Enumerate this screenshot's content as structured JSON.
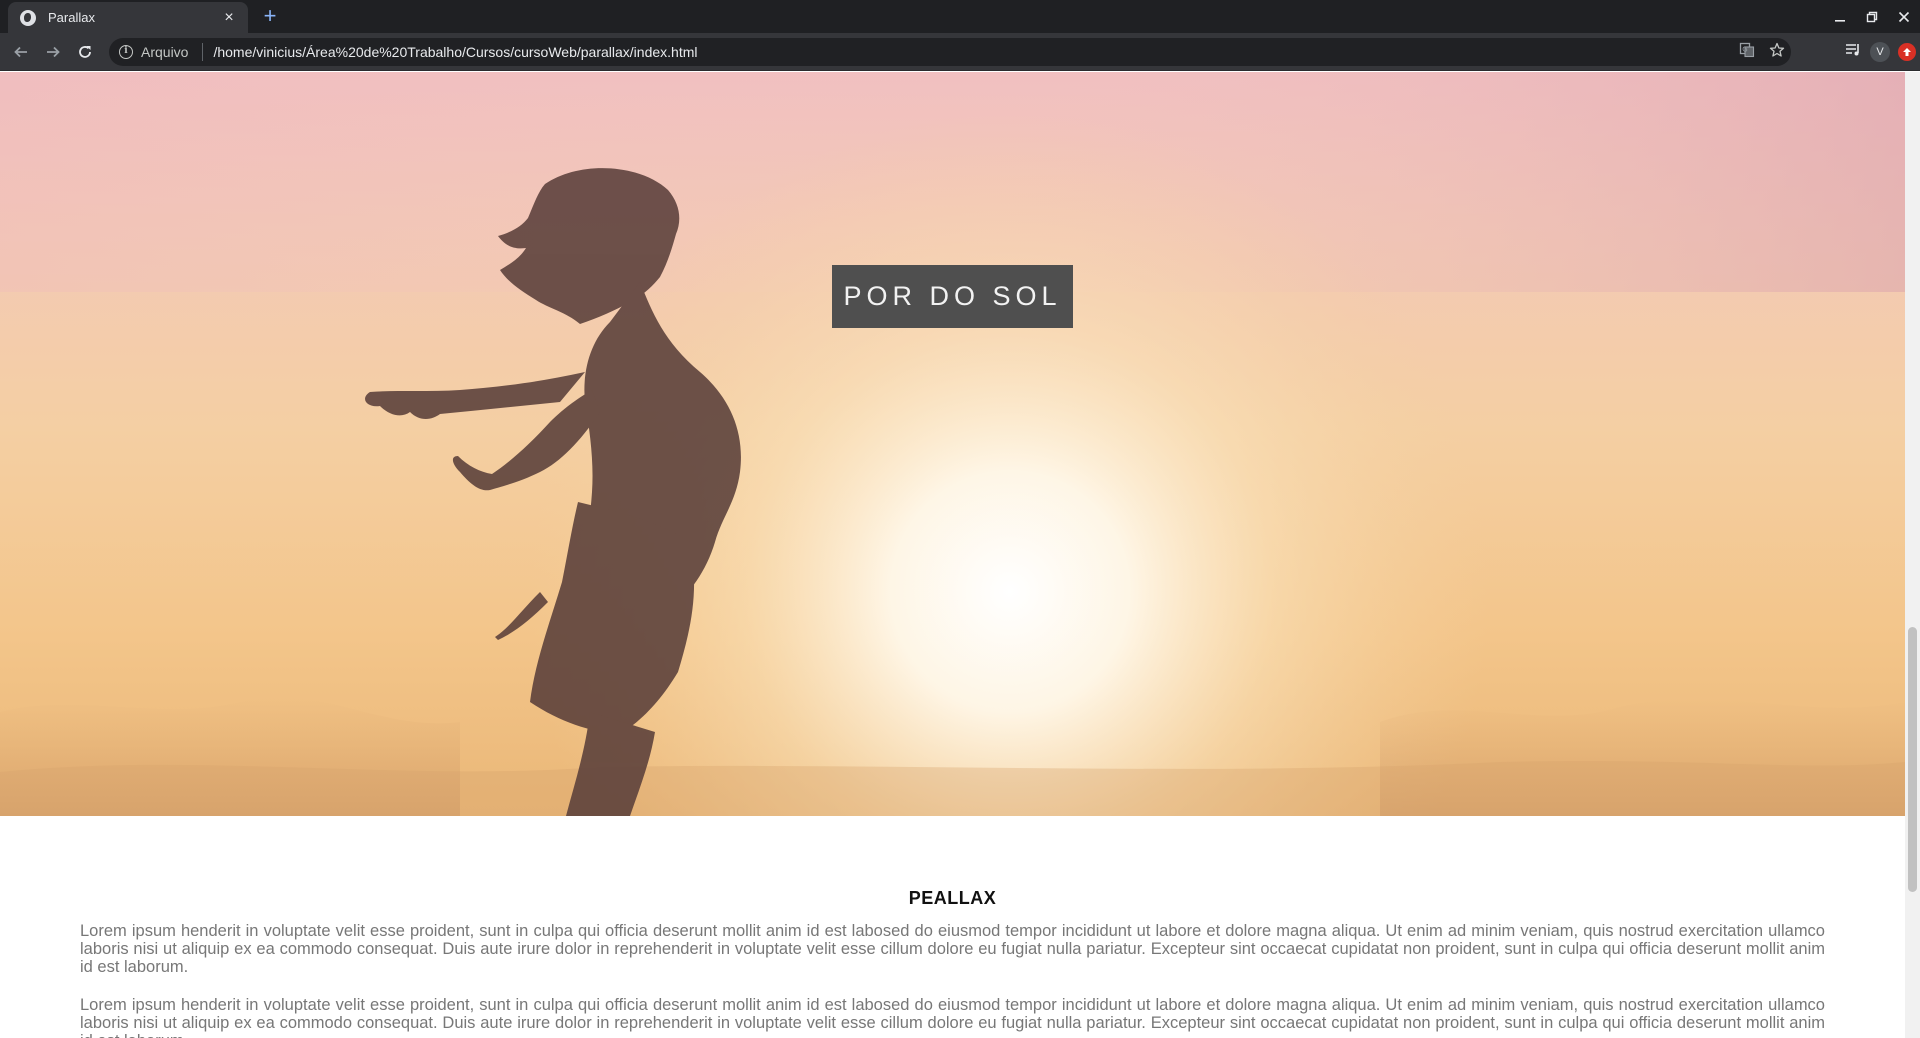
{
  "browser": {
    "tab_title": "Parallax",
    "new_tab_symbol": "+",
    "security_chip": "Arquivo",
    "url": "/home/vinicius/Área%20de%20Trabalho/Cursos/cursoWeb/parallax/index.html",
    "profile_initial": "V",
    "icons": [
      "globe-icon",
      "close-icon",
      "back-arrow-icon",
      "forward-arrow-icon",
      "reload-icon",
      "info-icon",
      "translate-icon",
      "star-icon",
      "media-queue-icon",
      "avatar",
      "extension-icon",
      "minimize-icon",
      "restore-icon",
      "window-close-icon"
    ]
  },
  "page": {
    "hero": {
      "caption": "POR DO SOL",
      "caption_bg": "#4f4f4f",
      "sky_colors": [
        "#f1c0c1",
        "#f4cfa3",
        "#eab777"
      ]
    },
    "section": {
      "heading": "PEALLAX",
      "paragraphs": [
        "Lorem ipsum henderit in voluptate velit esse proident, sunt in culpa qui officia deserunt mollit anim id est labosed do eiusmod tempor incididunt ut labore et dolore magna aliqua. Ut enim ad minim veniam, quis nostrud exercitation ullamco laboris nisi ut aliquip ex ea commodo consequat. Duis aute irure dolor in reprehenderit in voluptate velit esse cillum dolore eu fugiat nulla pariatur. Excepteur sint occaecat cupidatat non proident, sunt in culpa qui officia deserunt mollit anim id est laborum.",
        "Lorem ipsum henderit in voluptate velit esse proident, sunt in culpa qui officia deserunt mollit anim id est labosed do eiusmod tempor incididunt ut labore et dolore magna aliqua. Ut enim ad minim veniam, quis nostrud exercitation ullamco laboris nisi ut aliquip ex ea commodo consequat. Duis aute irure dolor in reprehenderit in voluptate velit esse cillum dolore eu fugiat nulla pariatur. Excepteur sint occaecat cupidatat non proident, sunt in culpa qui officia deserunt mollit anim id est laborum."
      ]
    }
  }
}
